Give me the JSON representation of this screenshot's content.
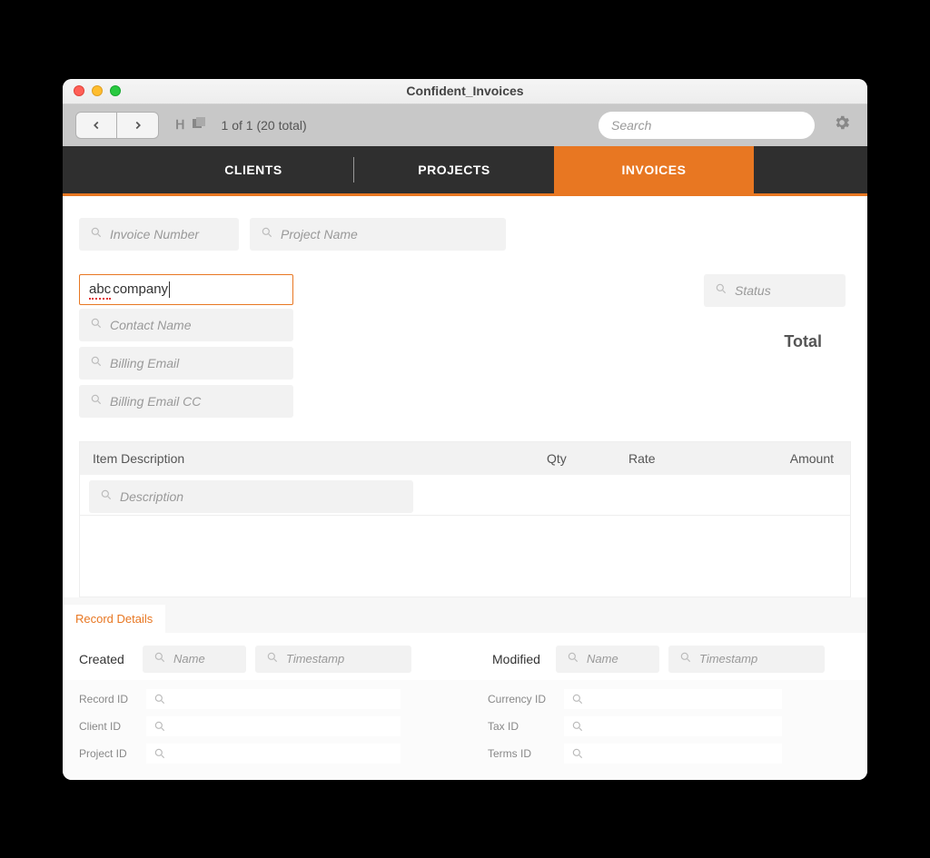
{
  "window": {
    "title": "Confident_Invoices"
  },
  "toolbar": {
    "count_text": "1 of 1  (20 total)",
    "search_placeholder": "Search"
  },
  "tabs": {
    "clients": "CLIENTS",
    "projects": "PROJECTS",
    "invoices": "INVOICES"
  },
  "filters": {
    "invoice_number": "Invoice Number",
    "project_name": "Project Name",
    "status": "Status"
  },
  "invoice": {
    "client_value_prefix": "abc",
    "client_value_rest": " company",
    "contact_name": "Contact Name",
    "billing_email": "Billing Email",
    "billing_email_cc": "Billing Email CC"
  },
  "labels": {
    "total": "Total",
    "record_details": "Record Details",
    "created": "Created",
    "modified": "Modified"
  },
  "items": {
    "head_desc": "Item Description",
    "head_qty": "Qty",
    "head_rate": "Rate",
    "head_amount": "Amount",
    "description_placeholder": "Description"
  },
  "details": {
    "name_ph": "Name",
    "timestamp_ph": "Timestamp"
  },
  "ids_left": {
    "record": "Record ID",
    "client": "Client ID",
    "project": "Project ID"
  },
  "ids_right": {
    "currency": "Currency ID",
    "tax": "Tax ID",
    "terms": "Terms ID"
  }
}
